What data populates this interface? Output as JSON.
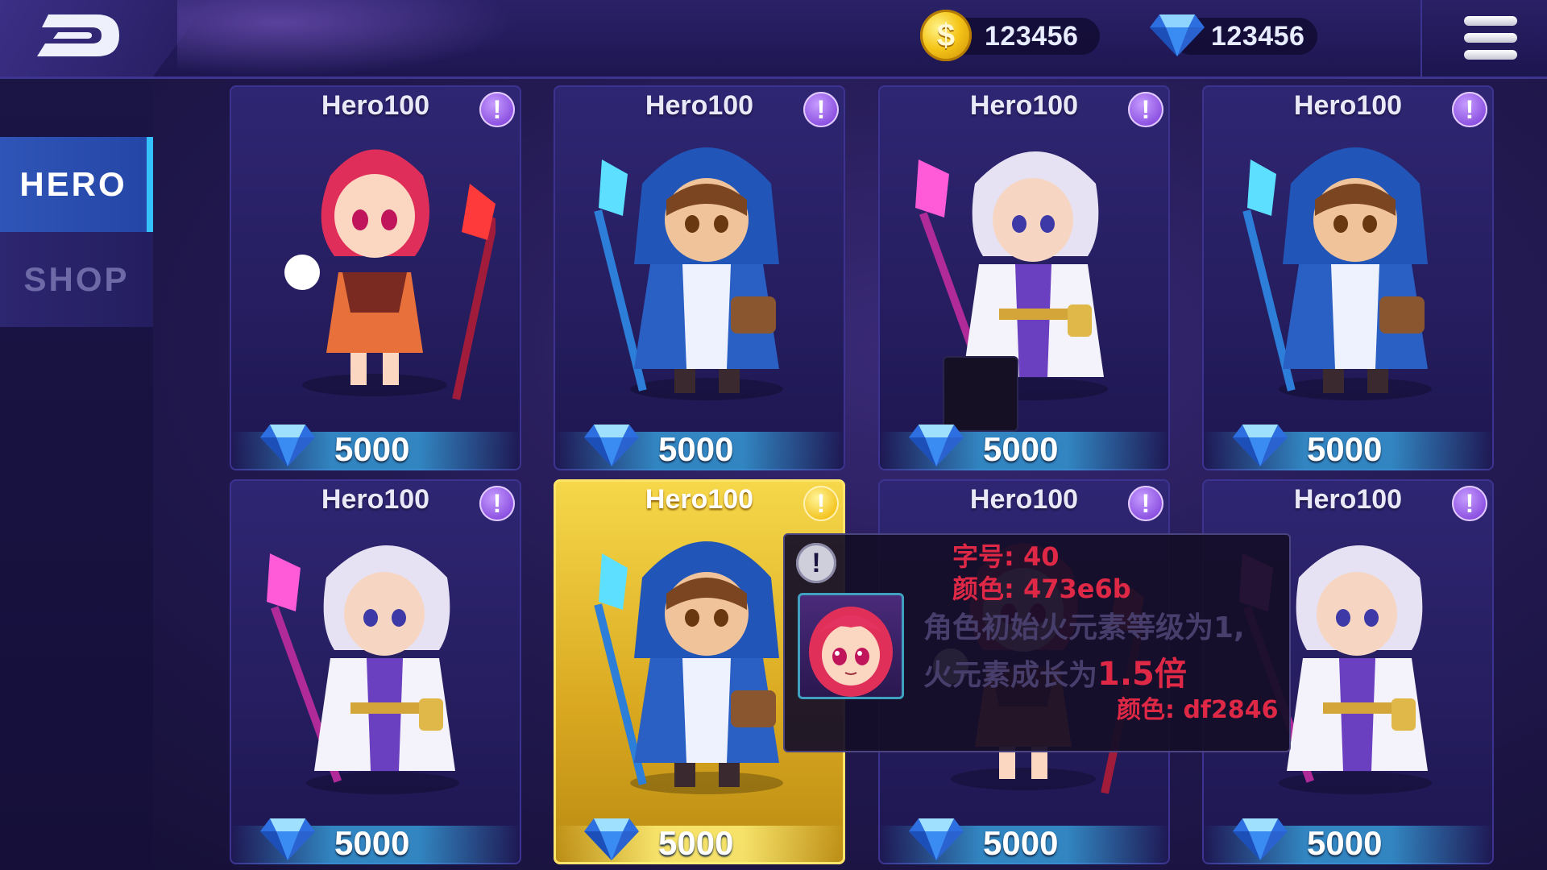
{
  "header": {
    "coins": "123456",
    "gems": "123456"
  },
  "nav": {
    "tabs": [
      {
        "label": "HERO",
        "active": true
      },
      {
        "label": "SHOP",
        "active": false
      }
    ]
  },
  "cards": [
    {
      "name": "Hero100",
      "price": "5000",
      "hero": "fire-mage-girl"
    },
    {
      "name": "Hero100",
      "price": "5000",
      "hero": "blue-hood-mage"
    },
    {
      "name": "Hero100",
      "price": "5000",
      "hero": "white-hair-mage"
    },
    {
      "name": "Hero100",
      "price": "5000",
      "hero": "blue-hood-mage"
    },
    {
      "name": "Hero100",
      "price": "5000",
      "hero": "white-hair-mage"
    },
    {
      "name": "Hero100",
      "price": "5000",
      "hero": "blue-hood-mage",
      "selected": true
    },
    {
      "name": "Hero100",
      "price": "5000",
      "hero": "fire-mage-girl"
    },
    {
      "name": "Hero100",
      "price": "5000",
      "hero": "white-hair-mage"
    }
  ],
  "tooltip": {
    "font_size_note": "字号: 40",
    "color_note_1": "颜色: 473e6b",
    "desc_line1": "角色初始火元素等级为1,",
    "desc_line2_prefix": "火元素成长为",
    "desc_line2_highlight": "1.5倍",
    "color_note_2": "颜色: df2846"
  },
  "colors": {
    "accent_blue": "#33c2ff",
    "desc_text": "#473e6b",
    "highlight_red": "#df2846",
    "selected_gold": "#f6d84a"
  }
}
